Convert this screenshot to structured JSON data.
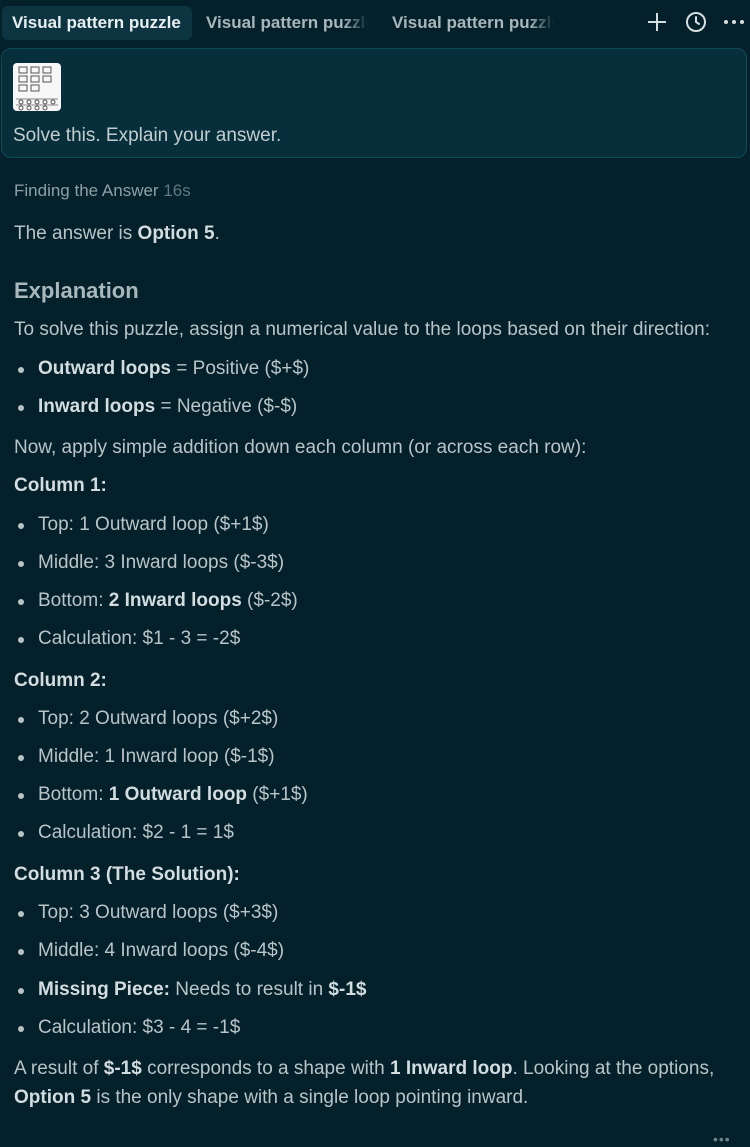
{
  "tabs": [
    "Visual pattern puzzle",
    "Visual pattern puzzle",
    "Visual pattern puzzle"
  ],
  "prompt": {
    "text": "Solve this. Explain your answer."
  },
  "status": {
    "label": "Finding the Answer",
    "time": "16s"
  },
  "answer": {
    "prefix": "The answer is ",
    "value": "Option 5",
    "suffix": "."
  },
  "explanation_title": "Explanation",
  "intro": "To solve this puzzle, assign a numerical value to the loops based on their direction:",
  "rules": [
    {
      "bold": "Outward loops",
      "text": " = Positive ($+$)"
    },
    {
      "bold": "Inward loops",
      "text": " = Negative ($-$)"
    }
  ],
  "apply": "Now, apply simple addition down each column (or across each row):",
  "col1": {
    "title": "Column 1:",
    "top": "Top: 1 Outward loop ($+1$)",
    "middle": "Middle: 3 Inward loops ($-3$)",
    "bottom_label": "Bottom: ",
    "bottom_bold": "2 Inward loops",
    "bottom_rest": " ($-2$)",
    "calc": "Calculation: $1 - 3 = -2$"
  },
  "col2": {
    "title": "Column 2:",
    "top": "Top: 2 Outward loops ($+2$)",
    "middle": "Middle: 1 Inward loop ($-1$)",
    "bottom_label": "Bottom: ",
    "bottom_bold": "1 Outward loop",
    "bottom_rest": " ($+1$)",
    "calc": "Calculation: $2 - 1 = 1$"
  },
  "col3": {
    "title": "Column 3 (The Solution):",
    "top": "Top: 3 Outward loops ($+3$)",
    "middle": "Middle: 4 Inward loops ($-4$)",
    "missing_bold": "Missing Piece:",
    "missing_text": " Needs to result in ",
    "missing_value": "$-1$",
    "calc": "Calculation: $3 - 4 = -1$"
  },
  "conclusion": {
    "p1": "A result of ",
    "b1": "$-1$",
    "p2": " corresponds to a shape with ",
    "b2": "1 Inward loop",
    "p3": ". Looking at the options, ",
    "b3": "Option 5",
    "p4": " is the only shape with a single loop pointing inward."
  },
  "icons": [
    "plus-icon",
    "clock-icon",
    "more-icon"
  ],
  "colors": {
    "background": "#03202b",
    "card": "#062f3b",
    "active_tab": "#0c3441"
  }
}
